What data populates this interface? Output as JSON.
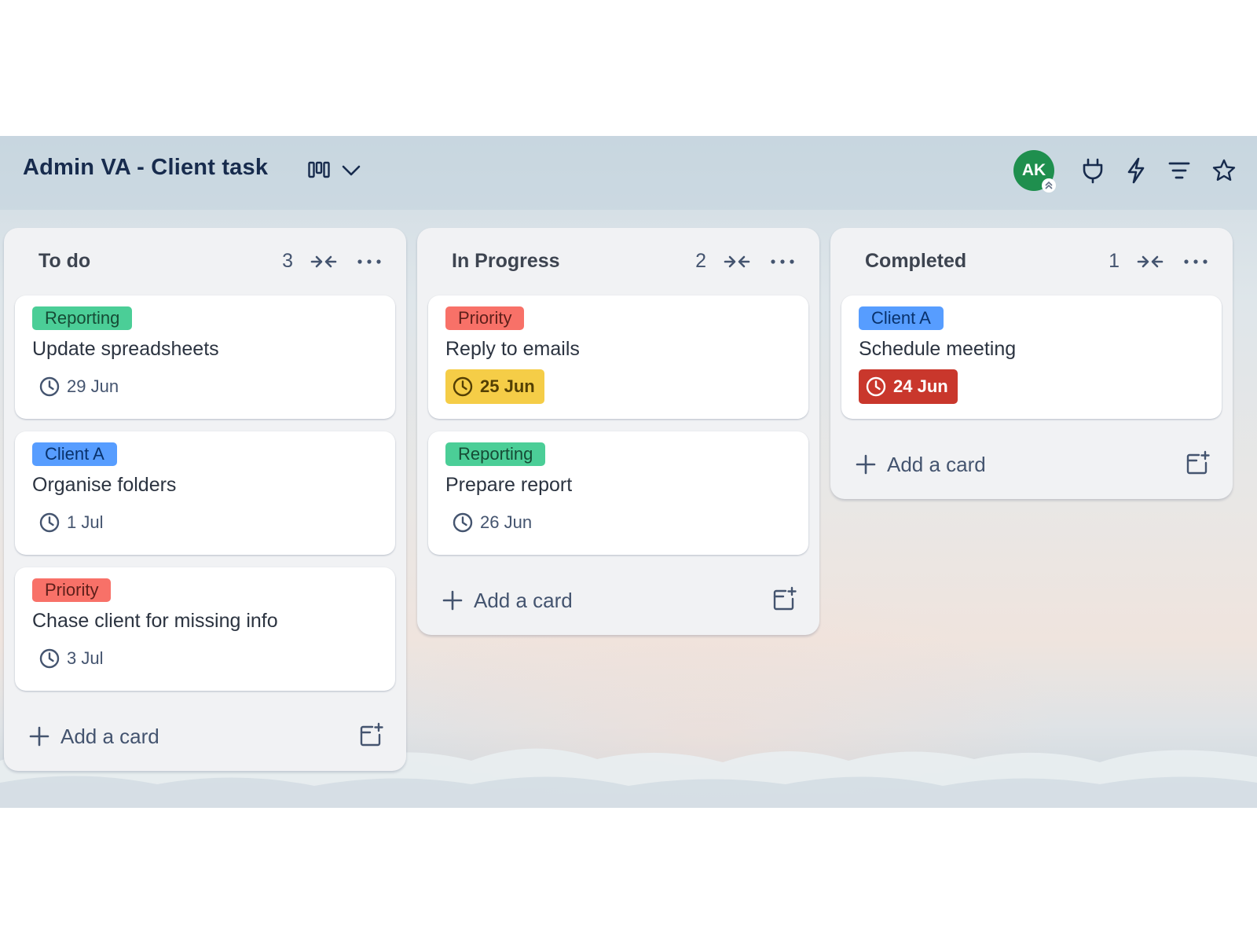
{
  "board": {
    "title": "Admin VA - Client task",
    "avatar_initials": "AK",
    "avatar_color": "#1f8f4e"
  },
  "header_icons": [
    "board-view-icon",
    "chevron-down-icon",
    "power-ups-icon",
    "automation-icon",
    "filter-icon",
    "star-icon"
  ],
  "lists": [
    {
      "title": "To do",
      "count": "3",
      "add_label": "Add a card",
      "cards": [
        {
          "label": "Reporting",
          "label_color": "#4bce97",
          "title": "Update spreadsheets",
          "due": "29 Jun",
          "due_status": "normal"
        },
        {
          "label": "Client A",
          "label_color": "#579dff",
          "title": "Organise folders",
          "due": "1 Jul",
          "due_status": "normal"
        },
        {
          "label": "Priority",
          "label_color": "#f87168",
          "title": "Chase client for missing info",
          "due": "3 Jul",
          "due_status": "normal"
        }
      ]
    },
    {
      "title": "In Progress",
      "count": "2",
      "add_label": "Add a card",
      "cards": [
        {
          "label": "Priority",
          "label_color": "#f87168",
          "title": "Reply to emails",
          "due": "25 Jun",
          "due_status": "due-soon",
          "due_color": "#f5cd47"
        },
        {
          "label": "Reporting",
          "label_color": "#4bce97",
          "title": "Prepare report",
          "due": "26 Jun",
          "due_status": "normal"
        }
      ]
    },
    {
      "title": "Completed",
      "count": "1",
      "add_label": "Add a card",
      "cards": [
        {
          "label": "Client A",
          "label_color": "#579dff",
          "title": "Schedule meeting",
          "due": "24 Jun",
          "due_status": "overdue",
          "due_color": "#c9372c"
        }
      ]
    }
  ]
}
